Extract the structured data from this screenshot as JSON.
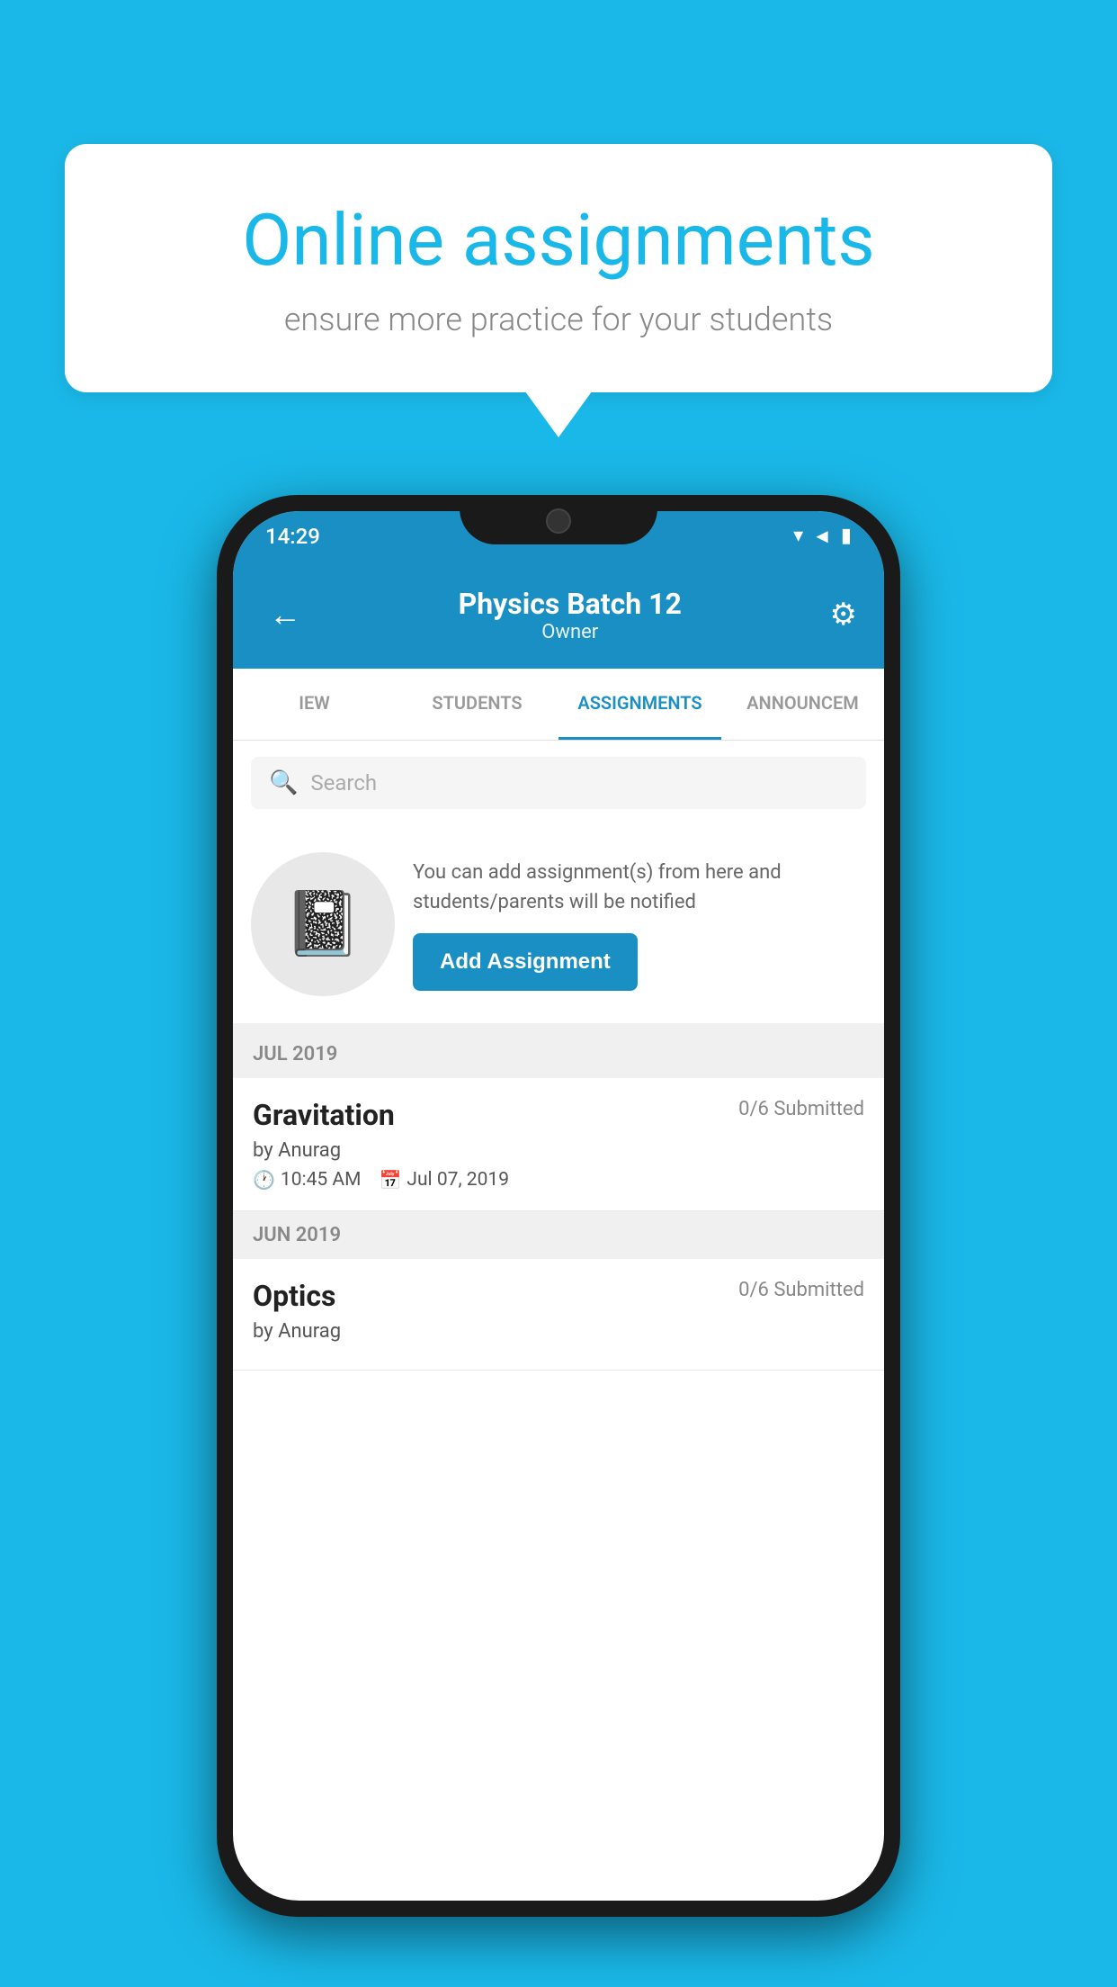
{
  "background_color": "#1ab8e8",
  "speech_bubble": {
    "title": "Online assignments",
    "subtitle": "ensure more practice for your students"
  },
  "phone": {
    "status_bar": {
      "time": "14:29",
      "icons": "▾◄▮"
    },
    "header": {
      "title": "Physics Batch 12",
      "subtitle": "Owner",
      "back_label": "←",
      "settings_label": "⚙"
    },
    "tabs": [
      {
        "label": "IEW",
        "active": false
      },
      {
        "label": "STUDENTS",
        "active": false
      },
      {
        "label": "ASSIGNMENTS",
        "active": true
      },
      {
        "label": "ANNOUNCEM",
        "active": false
      }
    ],
    "search": {
      "placeholder": "Search"
    },
    "promo": {
      "description": "You can add assignment(s) from here and students/parents will be notified",
      "button_label": "Add Assignment"
    },
    "sections": [
      {
        "month": "JUL 2019",
        "assignments": [
          {
            "title": "Gravitation",
            "submitted": "0/6 Submitted",
            "author": "by Anurag",
            "time": "10:45 AM",
            "date": "Jul 07, 2019"
          }
        ]
      },
      {
        "month": "JUN 2019",
        "assignments": [
          {
            "title": "Optics",
            "submitted": "0/6 Submitted",
            "author": "by Anurag",
            "time": "",
            "date": ""
          }
        ]
      }
    ]
  }
}
